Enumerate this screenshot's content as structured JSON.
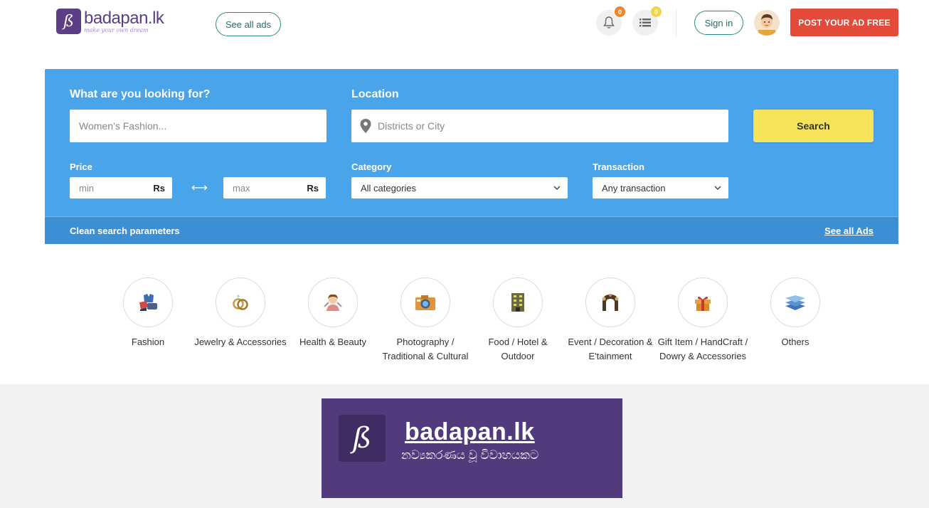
{
  "header": {
    "logo_text": "badapan.lk",
    "logo_tagline": "make your own dream",
    "see_all_ads": "See all ads",
    "notifications_count": "0",
    "list_count": "0",
    "sign_in": "Sign in",
    "post_ad": "POST YOUR AD FREE"
  },
  "search": {
    "what_label": "What are you looking for?",
    "what_placeholder": "Women’s Fashion...",
    "location_label": "Location",
    "location_placeholder": "Districts or City",
    "search_button": "Search",
    "price_label": "Price",
    "min_placeholder": "min",
    "max_placeholder": "max",
    "currency": "Rs",
    "category_label": "Category",
    "category_value": "All categories",
    "transaction_label": "Transaction",
    "transaction_value": "Any transaction",
    "clean": "Clean search parameters",
    "see_all": "See all Ads"
  },
  "categories": [
    {
      "label": "Fashion",
      "icon": "fashion-icon"
    },
    {
      "label": "Jewelry & Accessories",
      "icon": "rings-icon"
    },
    {
      "label": "Health & Beauty",
      "icon": "beauty-icon"
    },
    {
      "label": "Photography / Traditional & Cultural",
      "icon": "camera-icon"
    },
    {
      "label": "Food / Hotel & Outdoor",
      "icon": "hotel-icon"
    },
    {
      "label": "Event / Decoration & E'tainment",
      "icon": "arch-icon"
    },
    {
      "label": "Gift Item / HandCraft / Dowry & Accessories",
      "icon": "gift-icon"
    },
    {
      "label": "Others",
      "icon": "layers-icon"
    }
  ],
  "banner": {
    "title": "badapan.lk",
    "subtitle": "නව්‍යකරණය වූ විවාහයකට"
  },
  "colors": {
    "panel": "#4aa4ea",
    "post_button": "#e34a3a",
    "search_button": "#f7e35a",
    "brand_purple": "#523b7c"
  }
}
